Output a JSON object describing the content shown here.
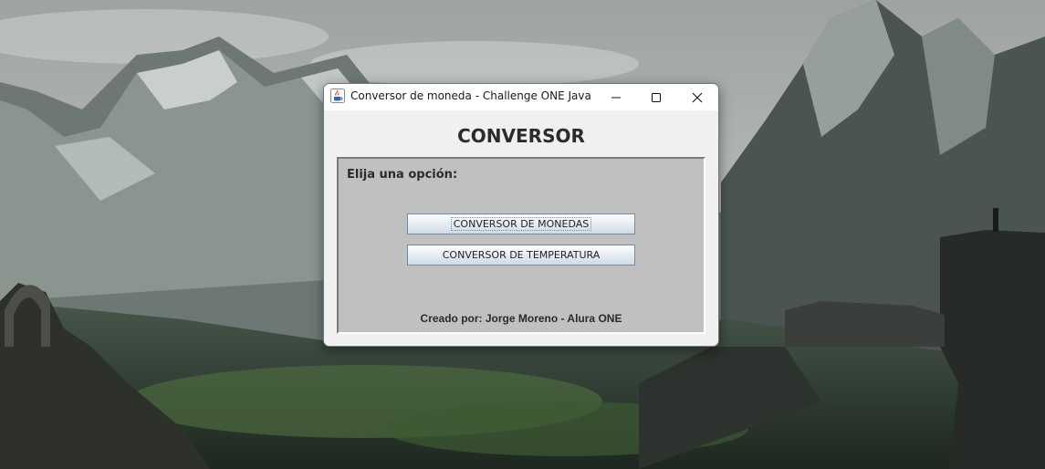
{
  "window": {
    "title": "Conversor de moneda - Challenge ONE Java",
    "icon": "java-coffee-icon",
    "controls": [
      "minimize-icon",
      "maximize-icon",
      "close-icon"
    ]
  },
  "content": {
    "heading": "CONVERSOR",
    "prompt": "Elija una opción:",
    "buttons": {
      "currency": "CONVERSOR DE MONEDAS",
      "temperature": "CONVERSOR DE TEMPERATURA"
    },
    "credit": "Creado por: Jorge Moreno - Alura ONE"
  },
  "colors": {
    "panel_bg": "#c0c0c0",
    "window_bg": "#f0f0f0",
    "titlebar_bg": "#ffffff"
  }
}
